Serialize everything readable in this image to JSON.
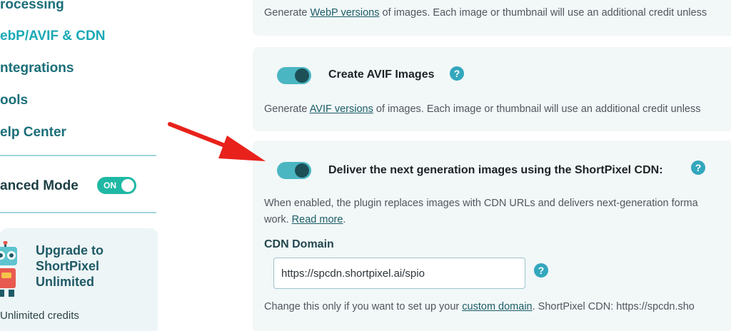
{
  "sidebar": {
    "nav": [
      {
        "label": "rocessing"
      },
      {
        "label": "ebP/AVIF & CDN"
      },
      {
        "label": "ntegrations"
      },
      {
        "label": "ools"
      },
      {
        "label": "elp Center"
      }
    ],
    "advanced_mode": {
      "label": "anced Mode",
      "toggle_text": "ON"
    },
    "upgrade": {
      "title": "Upgrade to ShortPixel Unlimited",
      "feature": "Unlimited credits"
    }
  },
  "webp": {
    "desc_prefix": "Generate ",
    "desc_link": "WebP versions",
    "desc_suffix": " of images. Each image or thumbnail will use an additional credit unless"
  },
  "avif": {
    "title": "Create AVIF Images",
    "desc_prefix": "Generate ",
    "desc_link": "AVIF versions",
    "desc_suffix": " of images. Each image or thumbnail will use an additional credit unless"
  },
  "cdn": {
    "title": "Deliver the next generation images using the ShortPixel CDN:",
    "desc_line1": "When enabled, the plugin replaces images with CDN URLs and delivers next-generation forma",
    "desc_line2_prefix": "work. ",
    "desc_line2_link": "Read more",
    "desc_line2_suffix": ".",
    "domain_label": "CDN Domain",
    "domain_value": "https://spcdn.shortpixel.ai/spio",
    "note_prefix": "Change this only if you want to set up your ",
    "note_link": "custom domain",
    "note_suffix": ". ShortPixel CDN: https://spcdn.sho"
  },
  "help_glyph": "?",
  "colors": {
    "accent": "#1aa9b5",
    "toggle_on": "#4ab6c2",
    "arrow": "#e8211b",
    "card_bg": "#f2f7f8"
  }
}
